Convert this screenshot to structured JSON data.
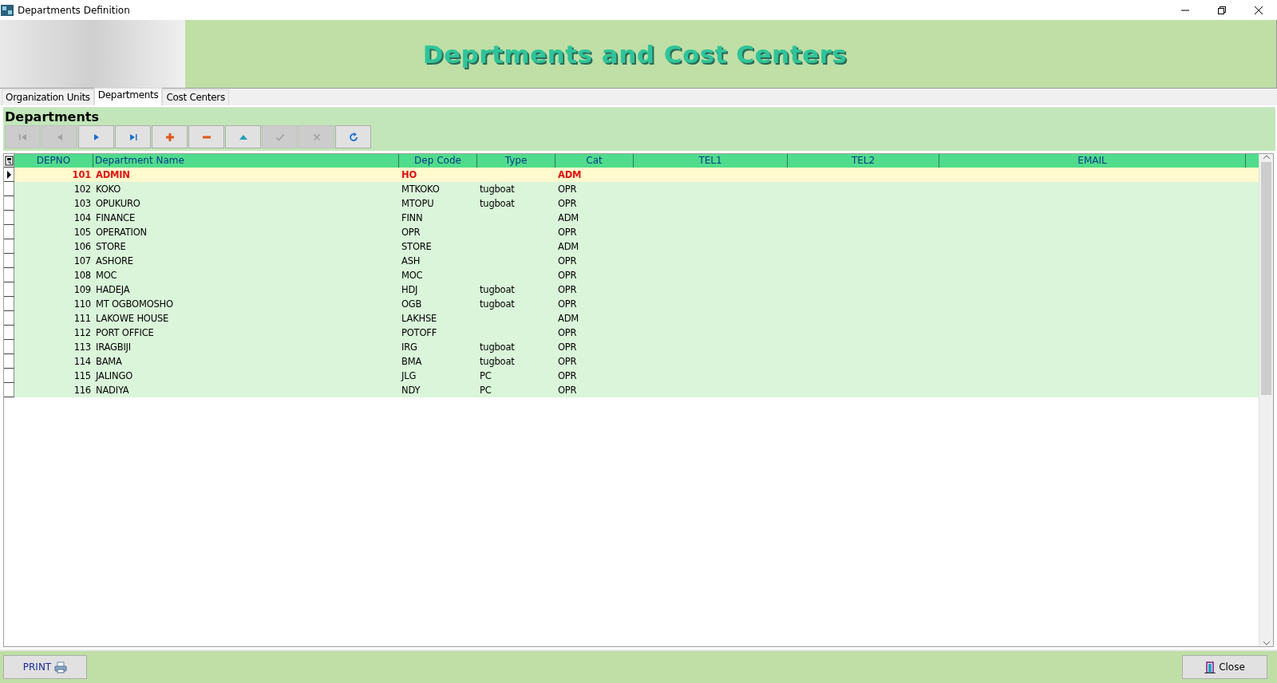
{
  "window": {
    "title": "Departments Definition"
  },
  "banner": {
    "title": "Deprtments and Cost Centers"
  },
  "tabs": [
    {
      "label": "Organization Units",
      "selected": false
    },
    {
      "label": "Departments",
      "selected": true
    },
    {
      "label": "Cost Centers",
      "selected": false
    }
  ],
  "panel": {
    "title": "Departments"
  },
  "toolbar": [
    {
      "kind": "first",
      "disabled": true
    },
    {
      "kind": "prior",
      "disabled": true
    },
    {
      "kind": "next",
      "disabled": false
    },
    {
      "kind": "last",
      "disabled": false
    },
    {
      "kind": "insert",
      "disabled": false
    },
    {
      "kind": "delete",
      "disabled": false
    },
    {
      "kind": "edit",
      "disabled": false
    },
    {
      "kind": "post",
      "disabled": true
    },
    {
      "kind": "cancel",
      "disabled": true
    },
    {
      "kind": "refresh",
      "disabled": false
    }
  ],
  "table": {
    "columns": [
      "DEPNO",
      "Department Name",
      "Dep Code",
      "Type",
      "Cat",
      "TEL1",
      "TEL2",
      "EMAIL"
    ],
    "rows": [
      {
        "cells": [
          "101",
          "ADMIN",
          "HO",
          "",
          "ADM",
          "",
          "",
          ""
        ],
        "selected": true
      },
      {
        "cells": [
          "102",
          "KOKO",
          "MTKOKO",
          "tugboat",
          "OPR",
          "",
          "",
          ""
        ],
        "selected": false
      },
      {
        "cells": [
          "103",
          "OPUKURO",
          "MTOPU",
          "tugboat",
          "OPR",
          "",
          "",
          ""
        ],
        "selected": false
      },
      {
        "cells": [
          "104",
          "FINANCE",
          "FINN",
          "",
          "ADM",
          "",
          "",
          ""
        ],
        "selected": false
      },
      {
        "cells": [
          "105",
          "OPERATION",
          "OPR",
          "",
          "OPR",
          "",
          "",
          ""
        ],
        "selected": false
      },
      {
        "cells": [
          "106",
          "STORE",
          "STORE",
          "",
          "ADM",
          "",
          "",
          ""
        ],
        "selected": false
      },
      {
        "cells": [
          "107",
          "ASHORE",
          "ASH",
          "",
          "OPR",
          "",
          "",
          ""
        ],
        "selected": false
      },
      {
        "cells": [
          "108",
          "MOC",
          "MOC",
          "",
          "OPR",
          "",
          "",
          ""
        ],
        "selected": false
      },
      {
        "cells": [
          "109",
          "HADEJA",
          "HDJ",
          "tugboat",
          "OPR",
          "",
          "",
          ""
        ],
        "selected": false
      },
      {
        "cells": [
          "110",
          "MT OGBOMOSHO",
          "OGB",
          "tugboat",
          "OPR",
          "",
          "",
          ""
        ],
        "selected": false
      },
      {
        "cells": [
          "111",
          "LAKOWE HOUSE",
          "LAKHSE",
          "",
          "ADM",
          "",
          "",
          ""
        ],
        "selected": false
      },
      {
        "cells": [
          "112",
          "PORT OFFICE",
          "POTOFF",
          "",
          "OPR",
          "",
          "",
          ""
        ],
        "selected": false
      },
      {
        "cells": [
          "113",
          "IRAGBIJI",
          "IRG",
          "tugboat",
          "OPR",
          "",
          "",
          ""
        ],
        "selected": false
      },
      {
        "cells": [
          "114",
          "BAMA",
          "BMA",
          "tugboat",
          "OPR",
          "",
          "",
          ""
        ],
        "selected": false
      },
      {
        "cells": [
          "115",
          "JALINGO",
          "JLG",
          "PC",
          "OPR",
          "",
          "",
          ""
        ],
        "selected": false
      },
      {
        "cells": [
          "116",
          "NADIYA",
          "NDY",
          "PC",
          "OPR",
          "",
          "",
          ""
        ],
        "selected": false
      }
    ]
  },
  "footer": {
    "print_button": "PRINT",
    "close_button": "Close"
  }
}
